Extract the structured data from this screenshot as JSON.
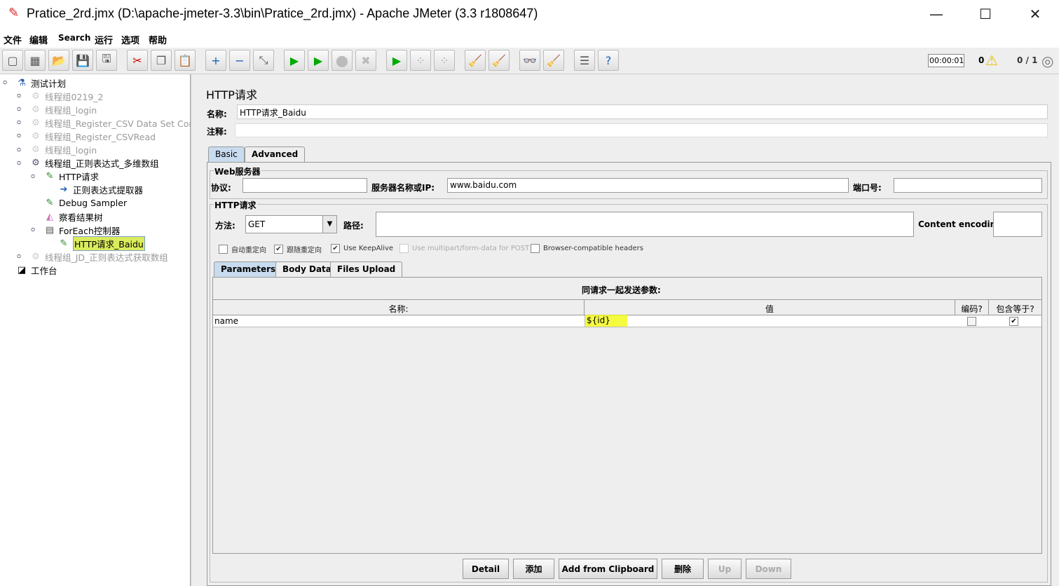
{
  "window": {
    "title": "Pratice_2rd.jmx (D:\\apache-jmeter-3.3\\bin\\Pratice_2rd.jmx) - Apache JMeter (3.3 r1808647)",
    "minimize": "—",
    "maximize": "☐",
    "close": "✕"
  },
  "menu": [
    "文件",
    "编辑",
    "Search",
    "运行",
    "选项",
    "帮助"
  ],
  "toolbar": {
    "icons": [
      "new-icon",
      "templates-icon",
      "open-icon",
      "save-icon",
      "save-as-icon",
      "cut-icon",
      "copy-icon",
      "paste-icon",
      "expand-icon",
      "collapse-icon",
      "toggle-icon",
      "start-icon",
      "start-no-pause-icon",
      "stop-icon",
      "shutdown-icon",
      "remote-start-icon",
      "remote-stop-icon",
      "remote-shutdown-icon",
      "clear-icon",
      "clear-all-icon",
      "search-icon",
      "reset-search-icon",
      "function-helper-icon",
      "help-icon"
    ],
    "glyphs": [
      "▢",
      "▦",
      "📂",
      "💾",
      "🖫",
      "✂",
      "❐",
      "📋",
      "+",
      "−",
      "⤡",
      "▶",
      "▶",
      "⬤",
      "✖",
      "▶",
      "⁘",
      "⁘",
      "🧹",
      "🧹",
      "👓",
      "🧹",
      "☰",
      "?"
    ],
    "timer": "00:00:01",
    "warnings": "0",
    "threads": "0 / 1"
  },
  "tree": [
    {
      "label": "测试计划",
      "level": 0,
      "icon": "test-plan-icon",
      "disabled": false
    },
    {
      "label": "线程组0219_2",
      "level": 1,
      "icon": "gear-icon",
      "disabled": true
    },
    {
      "label": "线程组_login",
      "level": 1,
      "icon": "gear-icon",
      "disabled": true
    },
    {
      "label": "线程组_Register_CSV Data Set Config",
      "level": 1,
      "icon": "gear-icon",
      "disabled": true
    },
    {
      "label": "线程组_Register_CSVRead",
      "level": 1,
      "icon": "gear-icon",
      "disabled": true
    },
    {
      "label": "线程组_login",
      "level": 1,
      "icon": "gear-icon",
      "disabled": true
    },
    {
      "label": "线程组_正则表达式_多维数组",
      "level": 1,
      "icon": "gear-icon",
      "disabled": false
    },
    {
      "label": "HTTP请求",
      "level": 2,
      "icon": "pipette-icon",
      "disabled": false
    },
    {
      "label": "正则表达式提取器",
      "level": 3,
      "icon": "extractor-icon",
      "disabled": false
    },
    {
      "label": "Debug Sampler",
      "level": 2,
      "icon": "pipette-icon",
      "disabled": false
    },
    {
      "label": "察看结果树",
      "level": 2,
      "icon": "result-tree-icon",
      "disabled": false
    },
    {
      "label": "ForEach控制器",
      "level": 2,
      "icon": "foreach-icon",
      "disabled": false
    },
    {
      "label": "HTTP请求_Baidu",
      "level": 3,
      "icon": "pipette-icon",
      "disabled": false,
      "selected": true
    },
    {
      "label": "线程组_JD_正则表达式获取数组",
      "level": 1,
      "icon": "gear-icon",
      "disabled": true
    },
    {
      "label": "工作台",
      "level": 0,
      "icon": "workbench-icon",
      "disabled": false
    }
  ],
  "panel": {
    "heading": "HTTP请求",
    "name_label": "名称:",
    "name_value": "HTTP请求_Baidu",
    "comment_label": "注释:",
    "comment_value": "",
    "tabs": [
      "Basic",
      "Advanced"
    ],
    "web_server": {
      "legend": "Web服务器",
      "protocol_label": "协议:",
      "protocol": "",
      "server_label": "服务器名称或IP:",
      "server": "www.baidu.com",
      "port_label": "端口号:",
      "port": ""
    },
    "http_request": {
      "legend": "HTTP请求",
      "method_label": "方法:",
      "method": "GET",
      "path_label": "路径:",
      "path": "",
      "encoding_label": "Content encoding:",
      "encoding": ""
    },
    "checkboxes": [
      {
        "label": "自动重定向",
        "checked": false,
        "enabled": true
      },
      {
        "label": "跟随重定向",
        "checked": true,
        "enabled": true
      },
      {
        "label": "Use KeepAlive",
        "checked": true,
        "enabled": true
      },
      {
        "label": "Use multipart/form-data for POST",
        "checked": false,
        "enabled": false
      },
      {
        "label": "Browser-compatible headers",
        "checked": false,
        "enabled": true
      }
    ],
    "subtabs": [
      "Parameters",
      "Body Data",
      "Files Upload"
    ],
    "params_title": "同请求一起发送参数:",
    "columns": [
      "名称:",
      "值",
      "编码?",
      "包含等于?"
    ],
    "rows": [
      {
        "name": "name",
        "value": "${id}",
        "encode": false,
        "include_equals": true
      }
    ],
    "buttons": [
      "Detail",
      "添加",
      "Add from Clipboard",
      "删除",
      "Up",
      "Down"
    ]
  }
}
